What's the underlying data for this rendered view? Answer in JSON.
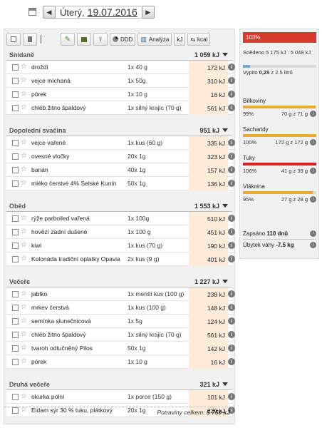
{
  "date": {
    "day": "Úterý,",
    "date": "19.07.2016"
  },
  "toolbar": {
    "ddd": "DDD",
    "analyza": "Analýza",
    "kj": "kJ",
    "kcal": "kcal"
  },
  "meals": [
    {
      "title": "Snídaně",
      "total": "1 059 kJ",
      "items": [
        {
          "name": "droždí",
          "amount": "1x 40 g",
          "kj": "172 kJ"
        },
        {
          "name": "vejce míchaná",
          "amount": "1x 50g",
          "kj": "310 kJ"
        },
        {
          "name": "pórek",
          "amount": "1x 10 g",
          "kj": "16 kJ"
        },
        {
          "name": "chléb žitno špaldový",
          "amount": "1x silný krajíc (70 g)",
          "kj": "561 kJ"
        }
      ]
    },
    {
      "title": "Dopolední svačina",
      "total": "951 kJ",
      "items": [
        {
          "name": "vejce vařené",
          "amount": "1x kus (60 g)",
          "kj": "335 kJ"
        },
        {
          "name": "ovesné vločky",
          "amount": "20x 1g",
          "kj": "323 kJ"
        },
        {
          "name": "banán",
          "amount": "40x 1g",
          "kj": "157 kJ"
        },
        {
          "name": "mléko čerstvé 4% Selské Kunín",
          "amount": "50x 1g",
          "kj": "136 kJ"
        }
      ]
    },
    {
      "title": "Oběd",
      "total": "1 553 kJ",
      "items": [
        {
          "name": "rýže parboiled vařená",
          "amount": "1x 100g",
          "kj": "510 kJ"
        },
        {
          "name": "hovězí zadní dušené",
          "amount": "1x 100 g",
          "kj": "451 kJ"
        },
        {
          "name": "kiwi",
          "amount": "1x kus (70 g)",
          "kj": "190 kJ"
        },
        {
          "name": "Kolonáda tradiční oplatky Opavia",
          "amount": "2x kus (9 g)",
          "kj": "401 kJ"
        }
      ]
    },
    {
      "title": "Večeře",
      "total": "1 227 kJ",
      "items": [
        {
          "name": "jablko",
          "amount": "1x menší kus (100 g)",
          "kj": "238 kJ"
        },
        {
          "name": "mrkev čerstvá",
          "amount": "1x kus (100 g)",
          "kj": "148 kJ"
        },
        {
          "name": "semínka slunečnicová",
          "amount": "1x 5g",
          "kj": "124 kJ"
        },
        {
          "name": "chléb žitno špaldový",
          "amount": "1x silný krajíc (70 g)",
          "kj": "561 kJ"
        },
        {
          "name": "tvaroh odtučněný Pilos",
          "amount": "50x 1g",
          "kj": "142 kJ"
        },
        {
          "name": "pórek",
          "amount": "1x 10 g",
          "kj": "16 kJ"
        }
      ]
    },
    {
      "title": "Druhá večeře",
      "total": "321 kJ",
      "items": [
        {
          "name": "okurka polní",
          "amount": "1x porce (150 g)",
          "kj": "101 kJ"
        },
        {
          "name": "Eidam sýr 30 % tuku, plátkový",
          "amount": "20x 1g",
          "kj": "220 kJ"
        }
      ]
    }
  ],
  "total_label": "Potraviny celkem:",
  "total_value": "5 750 kJ",
  "summary": {
    "percent": "103%",
    "eaten_label": "Snědeno",
    "eaten_value": "5 175 kJ : 5 048 kJ",
    "water_label": "Vypito",
    "water_value": "0,25",
    "water_total": "z 2.5 litrů",
    "water_fraction": 0.1,
    "nutrients": [
      {
        "name": "Bílkoviny",
        "percent": "99%",
        "value": "70 g z 71 g",
        "fraction": 0.99,
        "color": "#f0a830"
      },
      {
        "name": "Sacharidy",
        "percent": "100%",
        "value": "172 g z 172 g",
        "fraction": 1.0,
        "color": "#f0a830"
      },
      {
        "name": "Tuky",
        "percent": "106%",
        "value": "41 g z 39 g",
        "fraction": 1.0,
        "color": "#d8251b"
      },
      {
        "name": "Vláknina",
        "percent": "95%",
        "value": "27 g z 28 g",
        "fraction": 0.95,
        "color": "#f0a830"
      }
    ],
    "streak_label": "Zapsáno",
    "streak_value": "110 dnů",
    "weight_label": "Úbytek váhy",
    "weight_value": "-7.5 kg"
  }
}
